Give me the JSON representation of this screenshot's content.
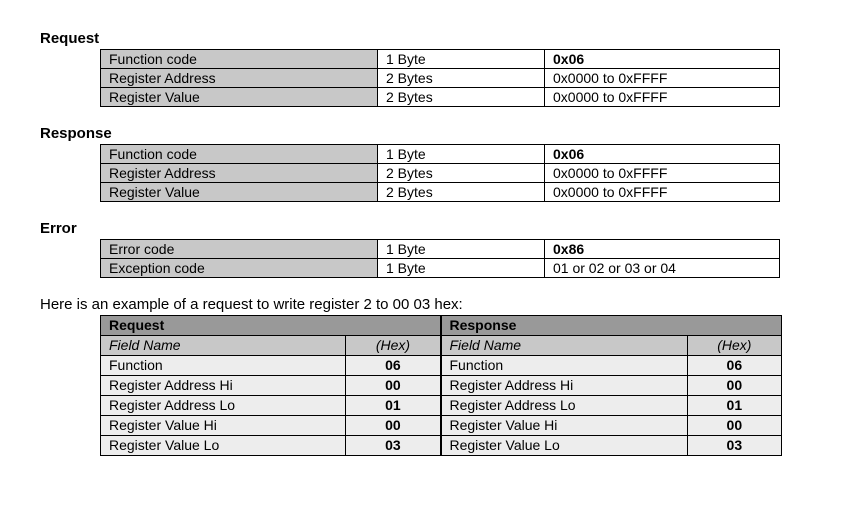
{
  "sections": {
    "request": {
      "title": "Request",
      "rows": [
        {
          "name": "Function code",
          "size": "1 Byte",
          "val": "0x06"
        },
        {
          "name": "Register Address",
          "size": "2 Bytes",
          "val": "0x0000 to 0xFFFF"
        },
        {
          "name": "Register Value",
          "size": "2 Bytes",
          "val": "0x0000 to 0xFFFF"
        }
      ]
    },
    "response": {
      "title": "Response",
      "rows": [
        {
          "name": "Function code",
          "size": "1 Byte",
          "val": "0x06"
        },
        {
          "name": "Register Address",
          "size": "2 Bytes",
          "val": "0x0000 to 0xFFFF"
        },
        {
          "name": "Register Value",
          "size": "2 Bytes",
          "val": "0x0000 to 0xFFFF"
        }
      ]
    },
    "error": {
      "title": "Error",
      "rows": [
        {
          "name": "Error code",
          "size": "1 Byte",
          "val": "0x86"
        },
        {
          "name": "Exception code",
          "size": "1 Byte",
          "val": "01 or 02 or 03 or 04"
        }
      ]
    }
  },
  "example": {
    "intro": "Here is an example of a request to write register 2 to 00 03 hex:",
    "left": {
      "header": "Request",
      "sub_name": "Field Name",
      "sub_val": "(Hex)",
      "rows": [
        {
          "name": "Function",
          "val": "06"
        },
        {
          "name": "Register Address Hi",
          "val": "00"
        },
        {
          "name": "Register Address Lo",
          "val": "01"
        },
        {
          "name": "Register Value Hi",
          "val": "00"
        },
        {
          "name": "Register Value Lo",
          "val": "03"
        }
      ]
    },
    "right": {
      "header": "Response",
      "sub_name": "Field Name",
      "sub_val": "(Hex)",
      "rows": [
        {
          "name": "Function",
          "val": "06"
        },
        {
          "name": "Register Address Hi",
          "val": "00"
        },
        {
          "name": "Register Address Lo",
          "val": "01"
        },
        {
          "name": "Register Value Hi",
          "val": "00"
        },
        {
          "name": "Register Value Lo",
          "val": "03"
        }
      ]
    }
  }
}
